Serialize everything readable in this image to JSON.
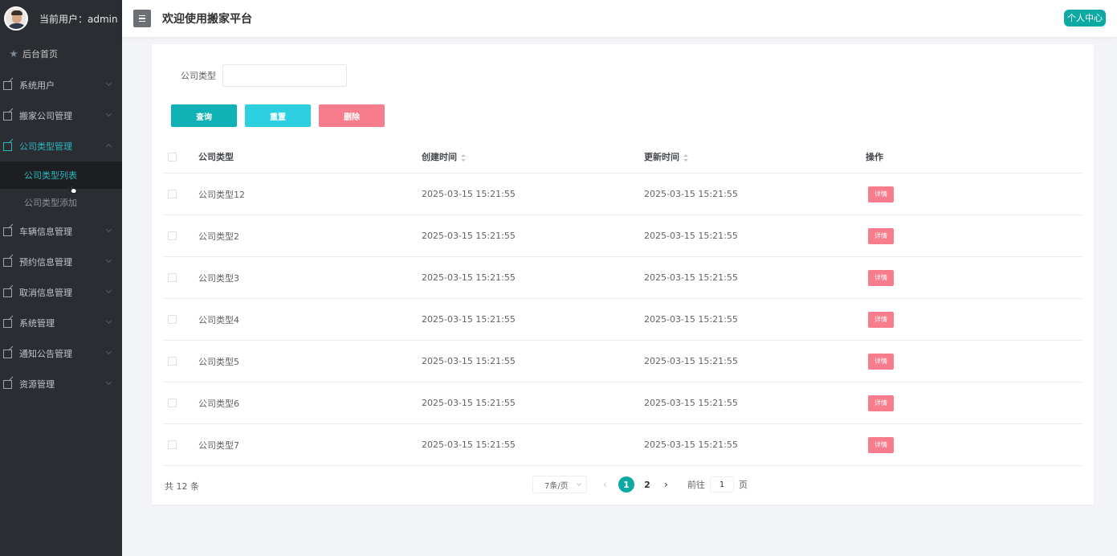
{
  "sidebar": {
    "current_user": "当前用户：admin",
    "home": "后台首页",
    "menus": [
      {
        "label": "系统用户"
      },
      {
        "label": "搬家公司管理"
      },
      {
        "label": "公司类型管理"
      },
      {
        "label": "车辆信息管理"
      },
      {
        "label": "预约信息管理"
      },
      {
        "label": "取消信息管理"
      },
      {
        "label": "系统管理"
      },
      {
        "label": "通知公告管理"
      },
      {
        "label": "资源管理"
      }
    ],
    "submenu": [
      {
        "label": "公司类型列表"
      },
      {
        "label": "公司类型添加"
      }
    ]
  },
  "header": {
    "title": "欢迎使用搬家平台",
    "personal_center": "个人中心"
  },
  "filter": {
    "label": "公司类型",
    "value": ""
  },
  "buttons": {
    "search": "查询",
    "reset": "重置",
    "delete": "删除"
  },
  "table": {
    "headers": {
      "name": "公司类型",
      "created": "创建时间",
      "updated": "更新时间",
      "ops": "操作"
    },
    "detail_label": "详情",
    "rows": [
      {
        "name": "公司类型12",
        "created": "2025-03-15 15:21:55",
        "updated": "2025-03-15 15:21:55"
      },
      {
        "name": "公司类型2",
        "created": "2025-03-15 15:21:55",
        "updated": "2025-03-15 15:21:55"
      },
      {
        "name": "公司类型3",
        "created": "2025-03-15 15:21:55",
        "updated": "2025-03-15 15:21:55"
      },
      {
        "name": "公司类型4",
        "created": "2025-03-15 15:21:55",
        "updated": "2025-03-15 15:21:55"
      },
      {
        "name": "公司类型5",
        "created": "2025-03-15 15:21:55",
        "updated": "2025-03-15 15:21:55"
      },
      {
        "name": "公司类型6",
        "created": "2025-03-15 15:21:55",
        "updated": "2025-03-15 15:21:55"
      },
      {
        "name": "公司类型7",
        "created": "2025-03-15 15:21:55",
        "updated": "2025-03-15 15:21:55"
      }
    ]
  },
  "pagination": {
    "total": "共 12 条",
    "page_size": "7条/页",
    "prev": "‹",
    "pages": [
      "1",
      "2"
    ],
    "next": "›",
    "goto_label": "前往",
    "goto_value": "1",
    "goto_suffix": "页"
  },
  "colors": {
    "sidebar_bg": "#2a2d31",
    "accent": "#0fa9a3",
    "danger": "#f77d8c",
    "reset": "#2dd0e0"
  }
}
